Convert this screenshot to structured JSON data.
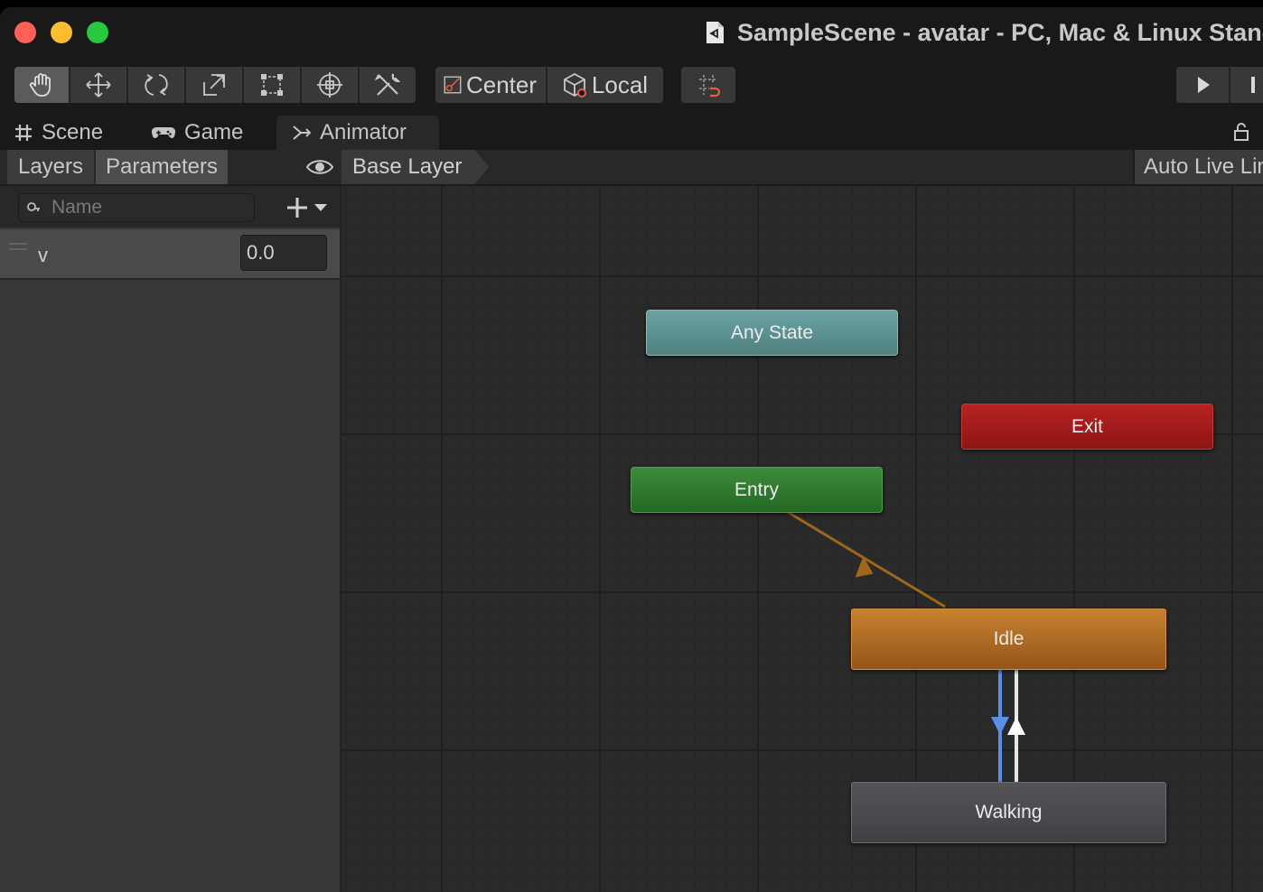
{
  "window": {
    "title": "SampleScene - avatar - PC, Mac & Linux Standalone"
  },
  "toolbar": {
    "tools": [
      "hand-tool",
      "move-tool",
      "rotate-tool",
      "scale-tool",
      "rect-tool",
      "transform-tool",
      "custom-editor-tool"
    ],
    "active_tool": "hand-tool",
    "pivot_label": "Center",
    "space_label": "Local"
  },
  "tabs": {
    "scene": "Scene",
    "game": "Game",
    "animator": "Animator",
    "active": "Animator"
  },
  "animator": {
    "subtabs": {
      "layers": "Layers",
      "parameters": "Parameters",
      "active": "Parameters"
    },
    "breadcrumb": "Base Layer",
    "live_link": "Auto Live Link",
    "search": {
      "placeholder": "Name",
      "value": ""
    },
    "parameters": [
      {
        "name": "v",
        "value": "0.0"
      }
    ],
    "states": {
      "any_state": "Any State",
      "exit": "Exit",
      "entry": "Entry",
      "idle": "Idle",
      "walking": "Walking"
    }
  },
  "colors": {
    "any_state": "#5f9595",
    "exit": "#a31b1b",
    "entry": "#2e7a2e",
    "idle_default": "#b56f25",
    "walking": "#4a4a4e",
    "transition_default": "#a0661c",
    "transition_selected": "#5b8ee6",
    "transition": "#e6e6e6"
  }
}
